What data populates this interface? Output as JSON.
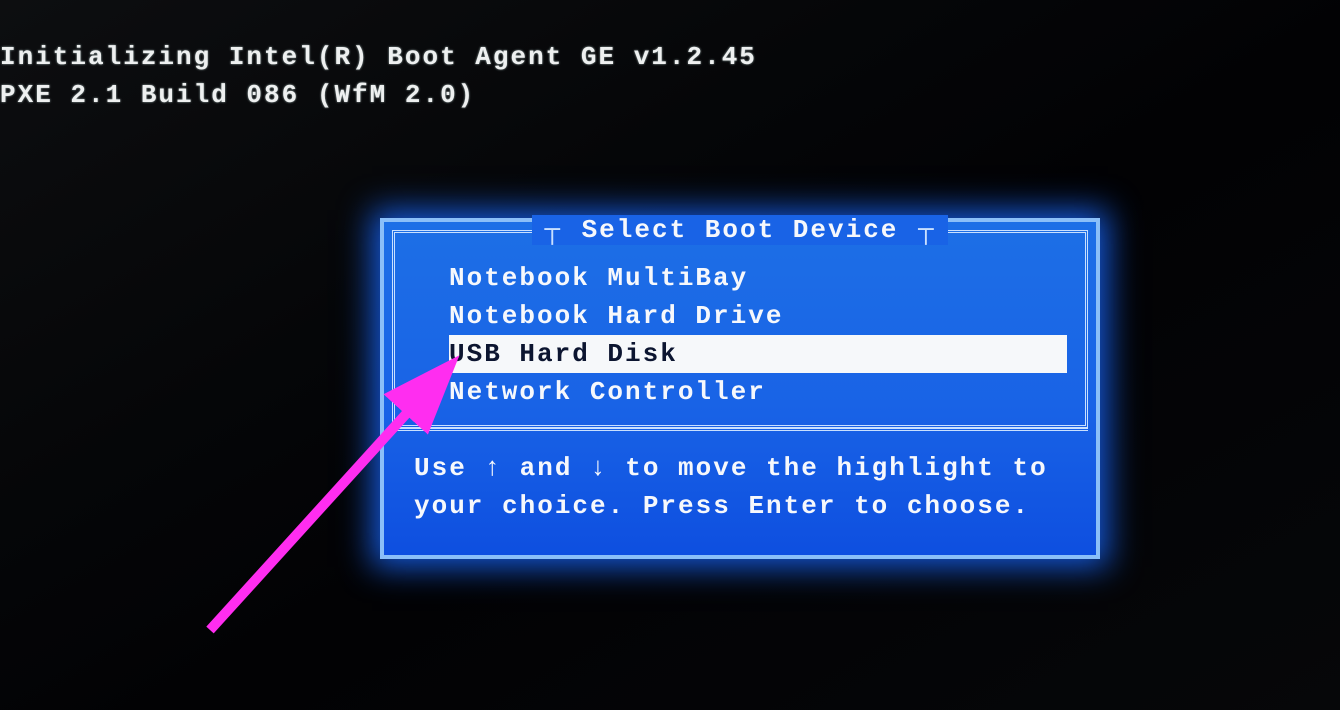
{
  "bios": {
    "line1": "Initializing Intel(R) Boot Agent GE v1.2.45",
    "line2": "PXE 2.1 Build 086 (WfM 2.0)"
  },
  "boot_menu": {
    "title": "Select Boot Device",
    "items": [
      {
        "label": "Notebook MultiBay",
        "selected": false
      },
      {
        "label": "Notebook Hard Drive",
        "selected": false
      },
      {
        "label": "USB Hard Disk",
        "selected": true
      },
      {
        "label": "Network Controller",
        "selected": false
      }
    ],
    "hint_line1": "Use ↑ and ↓ to move the highlight to",
    "hint_line2": "your choice.  Press Enter to choose."
  }
}
